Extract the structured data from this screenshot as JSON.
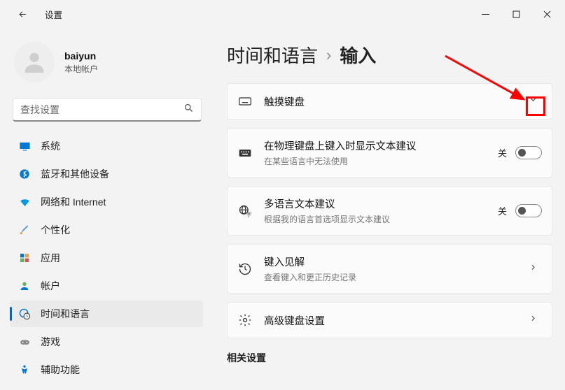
{
  "window": {
    "title": "设置"
  },
  "profile": {
    "name": "baiyun",
    "sub": "本地帐户"
  },
  "search": {
    "placeholder": "查找设置"
  },
  "sidebar": {
    "items": [
      {
        "label": "系统"
      },
      {
        "label": "蓝牙和其他设备"
      },
      {
        "label": "网络和 Internet"
      },
      {
        "label": "个性化"
      },
      {
        "label": "应用"
      },
      {
        "label": "帐户"
      },
      {
        "label": "时间和语言"
      },
      {
        "label": "游戏"
      },
      {
        "label": "辅助功能"
      }
    ]
  },
  "breadcrumb": {
    "parent": "时间和语言",
    "sep": "›",
    "current": "输入"
  },
  "cards": {
    "touchKeyboard": {
      "title": "触摸键盘"
    },
    "textSuggest": {
      "title": "在物理键盘上键入时显示文本建议",
      "sub": "在某些语言中无法使用",
      "state": "关"
    },
    "multiLang": {
      "title": "多语言文本建议",
      "sub": "根据我的语言首选项显示文本建议",
      "state": "关"
    },
    "insights": {
      "title": "键入见解",
      "sub": "查看键入和更正历史记录"
    },
    "advanced": {
      "title": "高级键盘设置"
    }
  },
  "sections": {
    "related": "相关设置"
  }
}
